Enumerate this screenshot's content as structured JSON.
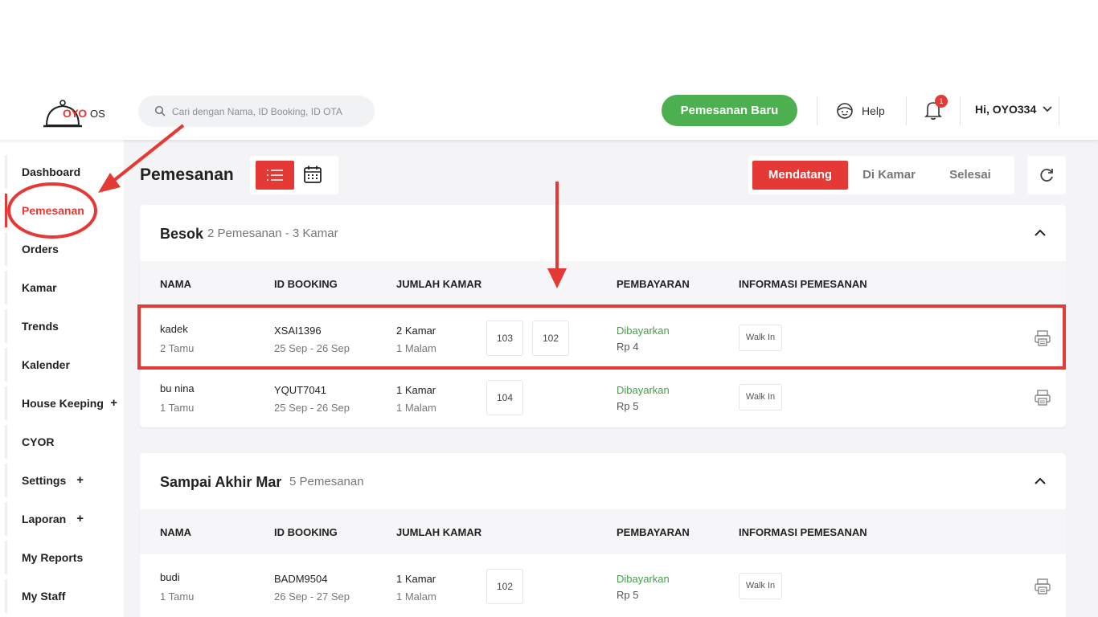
{
  "header": {
    "logo_text": "OYO",
    "logo_suffix": "OS",
    "search_placeholder": "Cari dengan Nama, ID Booking, ID OTA",
    "new_booking_label": "Pemesanan Baru",
    "help_label": "Help",
    "notification_count": "1",
    "user_greeting": "Hi, OYO334"
  },
  "sidebar": {
    "items": [
      {
        "label": "Dashboard",
        "plus": ""
      },
      {
        "label": "Pemesanan",
        "plus": ""
      },
      {
        "label": "Orders",
        "plus": ""
      },
      {
        "label": "Kamar",
        "plus": ""
      },
      {
        "label": "Trends",
        "plus": ""
      },
      {
        "label": "Kalender",
        "plus": ""
      },
      {
        "label": "House Keeping",
        "plus": "+"
      },
      {
        "label": "CYOR",
        "plus": ""
      },
      {
        "label": "Settings",
        "plus": "+"
      },
      {
        "label": "Laporan",
        "plus": "+"
      },
      {
        "label": "My Reports",
        "plus": ""
      },
      {
        "label": "My Staff",
        "plus": ""
      }
    ],
    "active_index": 1
  },
  "page": {
    "title": "Pemesanan",
    "tabs": [
      "Mendatang",
      "Di Kamar",
      "Selesai"
    ],
    "active_tab": 0
  },
  "columns": {
    "name": "NAMA",
    "booking_id": "ID BOOKING",
    "rooms": "JUMLAH KAMAR",
    "payment": "PEMBAYARAN",
    "info": "INFORMASI PEMESANAN"
  },
  "groups": [
    {
      "title": "Besok",
      "subtitle": "2 Pemesanan - 3 Kamar",
      "rows": [
        {
          "name": "kadek",
          "guests": "2 Tamu",
          "booking_id": "XSAI1396",
          "dates": "25 Sep - 26 Sep",
          "rooms_count": "2 Kamar",
          "nights": "1 Malam",
          "rooms": [
            "103",
            "102"
          ],
          "payment_status": "Dibayarkan",
          "amount": "Rp 4",
          "info": "Walk In"
        },
        {
          "name": "bu nina",
          "guests": "1 Tamu",
          "booking_id": "YQUT7041",
          "dates": "25 Sep - 26 Sep",
          "rooms_count": "1 Kamar",
          "nights": "1 Malam",
          "rooms": [
            "104"
          ],
          "payment_status": "Dibayarkan",
          "amount": "Rp 5",
          "info": "Walk In"
        }
      ]
    },
    {
      "title": "Sampai Akhir Mar",
      "subtitle": "5 Pemesanan",
      "rows": [
        {
          "name": "budi",
          "guests": "1 Tamu",
          "booking_id": "BADM9504",
          "dates": "26 Sep - 27 Sep",
          "rooms_count": "1 Kamar",
          "nights": "1 Malam",
          "rooms": [
            "102"
          ],
          "payment_status": "Dibayarkan",
          "amount": "Rp 5",
          "info": "Walk In"
        }
      ]
    }
  ],
  "colors": {
    "accent": "#e53935",
    "primary_button": "#4caf50",
    "paid": "#43a047"
  },
  "icons": [
    "oyo-bell-logo-icon",
    "search-icon",
    "help-face-icon",
    "bell-icon",
    "chevron-down-icon",
    "list-view-icon",
    "calendar-view-icon",
    "refresh-icon",
    "chevron-up-icon",
    "print-icon"
  ]
}
